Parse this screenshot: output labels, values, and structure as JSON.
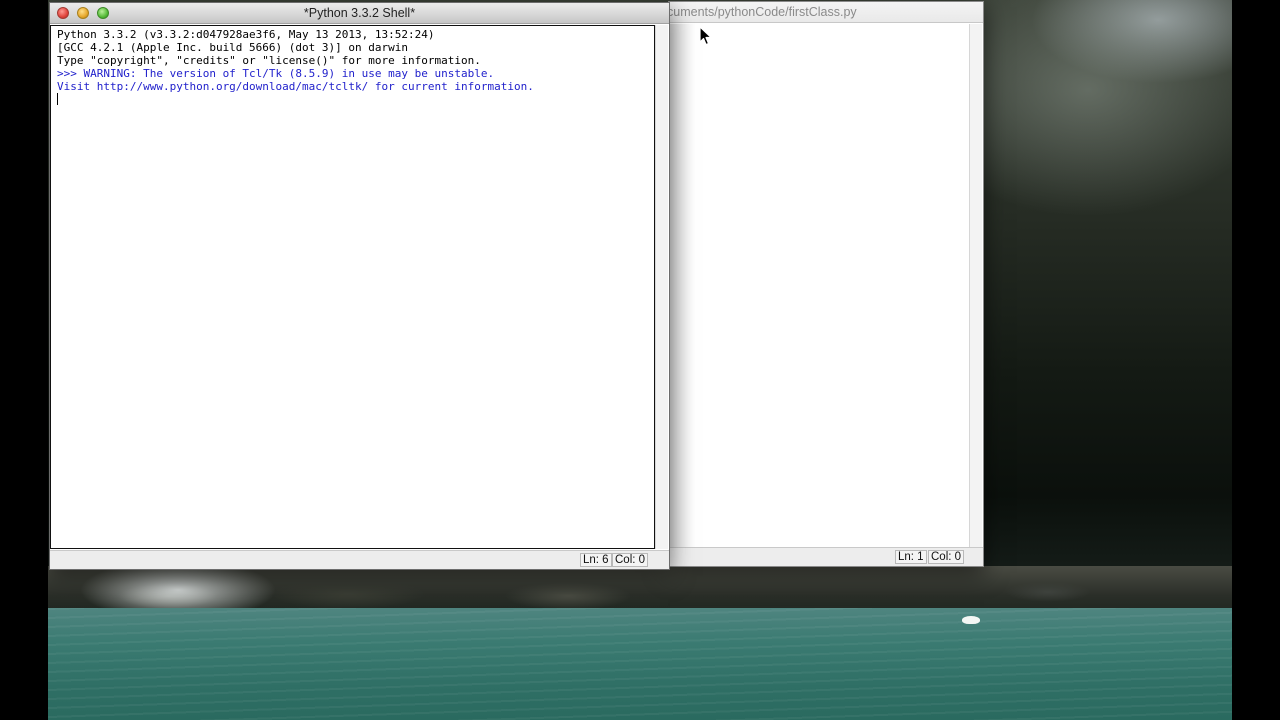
{
  "desktop": {
    "background": "niagara-river-photo"
  },
  "shell_window": {
    "title": "*Python 3.3.2 Shell*",
    "lines": [
      "Python 3.3.2 (v3.3.2:d047928ae3f6, May 13 2013, 13:52:24)",
      "[GCC 4.2.1 (Apple Inc. build 5666) (dot 3)] on darwin",
      "Type \"copyright\", \"credits\" or \"license()\" for more information.",
      ">>> WARNING: The version of Tcl/Tk (8.5.9) in use may be unstable.",
      "Visit http://www.python.org/download/mac/tcltk/ for current information."
    ],
    "warning_color": "#2222cc",
    "status_ln": "Ln: 6",
    "status_col": "Col: 0"
  },
  "editor_window": {
    "title": "cuments/pythonCode/firstClass.py",
    "status_ln": "Ln: 1",
    "status_col": "Col: 0"
  },
  "icons": {
    "close": "close-icon",
    "minimize": "minimize-icon",
    "zoom": "zoom-icon",
    "cursor": "mouse-pointer-icon"
  }
}
